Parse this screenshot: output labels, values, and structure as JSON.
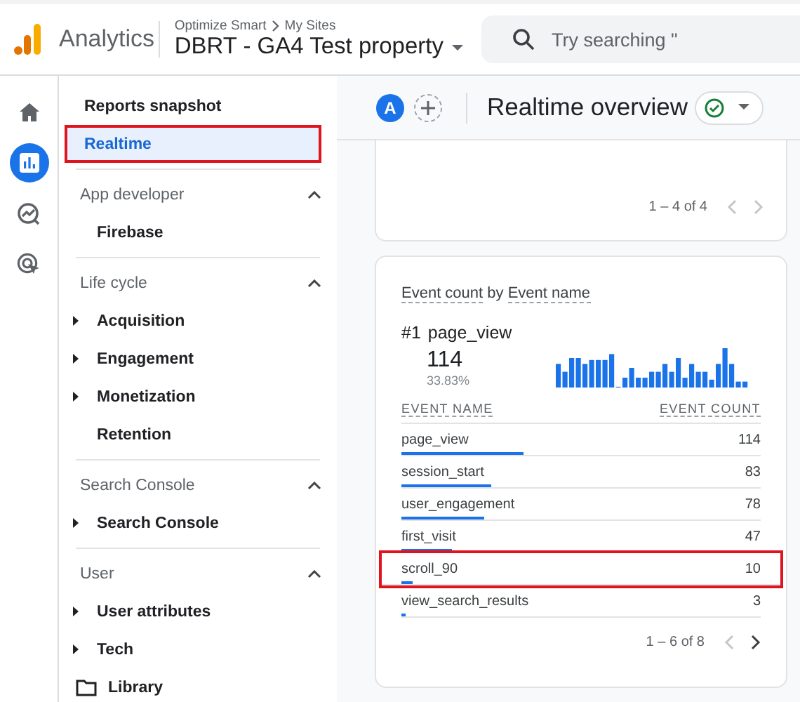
{
  "header": {
    "product": "Analytics",
    "breadcrumb": [
      "Optimize Smart",
      "My Sites"
    ],
    "property": "DBRT - GA4 Test property",
    "search": {
      "placeholder": "Try searching \""
    }
  },
  "rail": [
    {
      "kind": "home",
      "selected": false
    },
    {
      "kind": "reports",
      "selected": true
    },
    {
      "kind": "explore",
      "selected": false
    },
    {
      "kind": "advertising",
      "selected": false
    }
  ],
  "nav": {
    "top": [
      {
        "label": "Reports snapshot",
        "selected": false,
        "highlighted": false
      },
      {
        "label": "Realtime",
        "selected": true,
        "highlighted": true
      }
    ],
    "sections": [
      {
        "title": "App developer",
        "expanded": true,
        "items": [
          {
            "label": "Firebase",
            "expandable": false
          }
        ]
      },
      {
        "title": "Life cycle",
        "expanded": true,
        "items": [
          {
            "label": "Acquisition",
            "expandable": true
          },
          {
            "label": "Engagement",
            "expandable": true
          },
          {
            "label": "Monetization",
            "expandable": true
          },
          {
            "label": "Retention",
            "expandable": false
          }
        ]
      },
      {
        "title": "Search Console",
        "expanded": true,
        "items": [
          {
            "label": "Search Console",
            "expandable": true
          }
        ]
      },
      {
        "title": "User",
        "expanded": true,
        "items": [
          {
            "label": "User attributes",
            "expandable": true
          },
          {
            "label": "Tech",
            "expandable": true
          }
        ]
      }
    ],
    "library": "Library"
  },
  "toolbar": {
    "avatar": "A",
    "title": "Realtime overview"
  },
  "top_card": {
    "pagination": "1 – 4 of 4",
    "prev_disabled": true,
    "next_disabled": true
  },
  "event_card": {
    "metric": "Event count",
    "connector": "by",
    "dimension": "Event name",
    "top": {
      "rank": "#1",
      "name": "page_view",
      "count": "114",
      "share": "33.83%"
    },
    "columns": [
      "EVENT NAME",
      "EVENT COUNT"
    ],
    "rows": [
      {
        "name": "page_view",
        "count": "114",
        "level": 0.34,
        "highlighted": false
      },
      {
        "name": "session_start",
        "count": "83",
        "level": 0.25,
        "highlighted": false
      },
      {
        "name": "user_engagement",
        "count": "78",
        "level": 0.23,
        "highlighted": false
      },
      {
        "name": "first_visit",
        "count": "47",
        "level": 0.14,
        "highlighted": false
      },
      {
        "name": "scroll_90",
        "count": "10",
        "level": 0.03,
        "highlighted": true
      },
      {
        "name": "view_search_results",
        "count": "3",
        "level": 0.01,
        "highlighted": false
      }
    ],
    "pagination": "1 – 6 of 8",
    "prev_disabled": true,
    "next_disabled": false
  }
}
